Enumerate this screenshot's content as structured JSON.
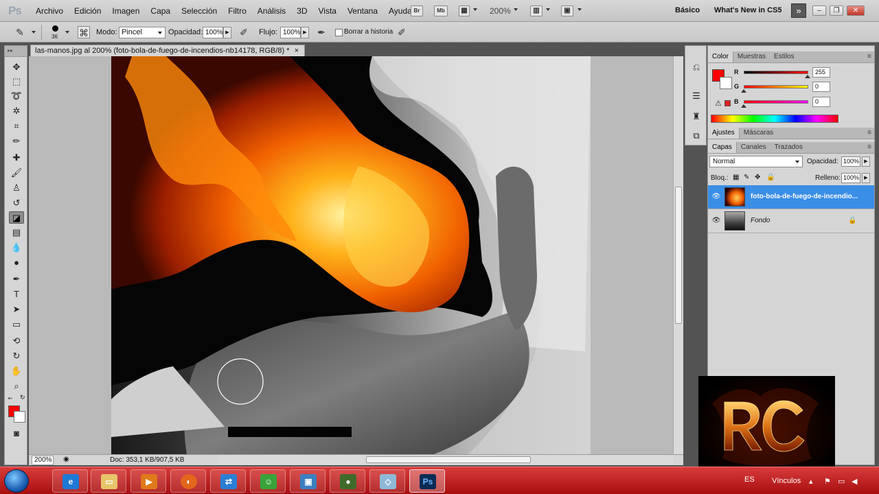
{
  "app": {
    "logo": "Ps",
    "menu": [
      "Archivo",
      "Edición",
      "Imagen",
      "Capa",
      "Selección",
      "Filtro",
      "Análisis",
      "3D",
      "Vista",
      "Ventana",
      "Ayuda"
    ],
    "bridge_label": "Br",
    "minibridge_label": "Mb",
    "zoom": "200%",
    "workspace": "Básico",
    "whats_new": "What's New in CS5",
    "more": "»"
  },
  "options": {
    "brush_size": "36",
    "mode_label": "Modo:",
    "mode_value": "Pincel",
    "opacity_label": "Opacidad:",
    "opacity_value": "100%",
    "flow_label": "Flujo:",
    "flow_value": "100%",
    "history_label": "Borrar a historia"
  },
  "document": {
    "tab_title": "las-manos.jpg al 200% (foto-bola-de-fuego-de-incendios-nb14178, RGB/8) *",
    "close": "×",
    "zoom": "200%",
    "doc_info": "Doc: 353,1 KB/907,5 KB"
  },
  "color_panel": {
    "tabs": [
      "Color",
      "Muestras",
      "Estilos"
    ],
    "channels": [
      {
        "label": "R",
        "value": "255"
      },
      {
        "label": "G",
        "value": "0"
      },
      {
        "label": "B",
        "value": "0"
      }
    ],
    "foreground": "#ff0000",
    "background": "#ffffff"
  },
  "adjust_panel": {
    "tabs": [
      "Ajustes",
      "Máscaras"
    ]
  },
  "layers_panel": {
    "tabs": [
      "Capas",
      "Canales",
      "Trazados"
    ],
    "blend_mode": "Normal",
    "opacity_label": "Opacidad:",
    "opacity_value": "100%",
    "lock_label": "Bloq.:",
    "fill_label": "Relleno:",
    "fill_value": "100%",
    "layers": [
      {
        "name": "foto-bola-de-fuego-de-incendio...",
        "selected": true
      },
      {
        "name": "Fondo",
        "selected": false,
        "locked": true
      }
    ]
  },
  "watermark": {
    "text": "RC"
  },
  "taskbar": {
    "language": "ES",
    "links": "Vínculos"
  }
}
